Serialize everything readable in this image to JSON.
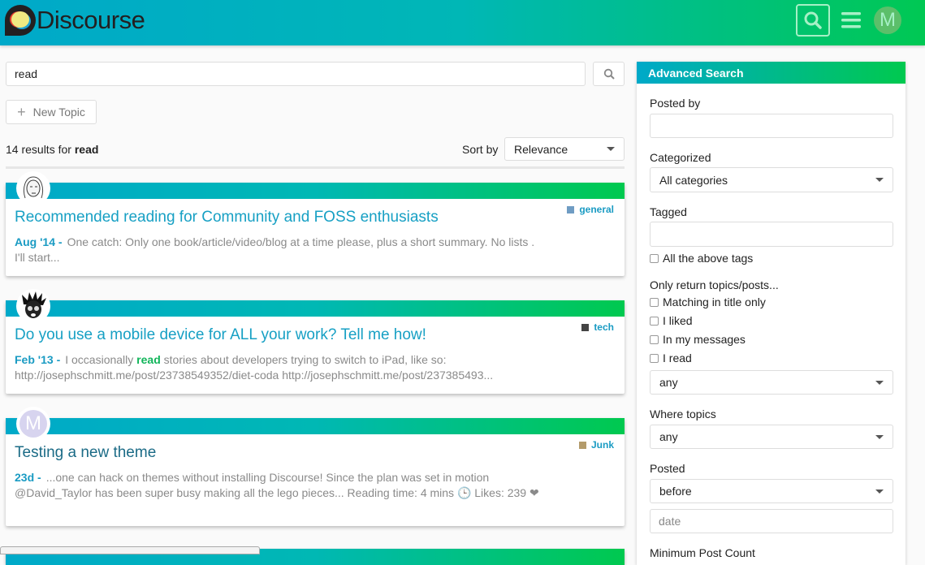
{
  "header": {
    "logo_text": "Discourse",
    "avatar_letter": "M",
    "icons": [
      "search-icon",
      "hamburger-menu-icon",
      "user-avatar"
    ]
  },
  "search": {
    "value": "read",
    "button_icon": "search-icon"
  },
  "new_topic": {
    "icon": "plus-icon",
    "label": "New Topic"
  },
  "results": {
    "count_prefix": "14 results for ",
    "term": "read",
    "sort_label": "Sort by",
    "sort_value": "Relevance"
  },
  "colors": {
    "accent": "#00a9c9",
    "accent_end": "#00c94f",
    "link": "#1a9bc3",
    "highlight": "#11b55a"
  },
  "topics": [
    {
      "title": "Recommended reading for Community and FOSS enthusiasts",
      "category": "general",
      "category_color": "#6f9cc3",
      "date": "Aug '14 -",
      "blurb_before": "One catch: Only one book/article/video/blog at a time please, plus a short summary. No lists . I'll start...",
      "highlight": "",
      "blurb_after": "",
      "avatar": "sketch-portrait"
    },
    {
      "title": "Do you use a mobile device for ALL your work? Tell me how!",
      "category": "tech",
      "category_color": "#444444",
      "date": "Feb '13 -",
      "blurb_before": "I occasionally ",
      "highlight": "read",
      "blurb_after": " stories about developers trying to switch to iPad, like so: http://josephschmitt.me/post/23738549352/diet-coda http://josephschmitt.me/post/237385493...",
      "avatar": "spiky-hair-cartoon"
    },
    {
      "title": "Testing a new theme",
      "category": "Junk",
      "category_color": "#b39b6b",
      "date": "23d -",
      "blurb_before": "...one can hack on themes without installing Discourse! Since the plan was set in motion @David_Taylor has been super busy making all the lego pieces... Reading time: 4 mins 🕒 Likes: 239 ❤",
      "highlight": "",
      "blurb_after": "",
      "avatar": "M"
    }
  ],
  "advanced": {
    "title": "Advanced Search",
    "posted_by": "Posted by",
    "categorized": "Categorized",
    "category_value": "All categories",
    "tagged": "Tagged",
    "all_tags": "All the above tags",
    "only_return": "Only return topics/posts...",
    "checks": [
      "Matching in title only",
      "I liked",
      "In my messages",
      "I read"
    ],
    "only_select": "any",
    "where_topics": "Where topics",
    "where_value": "any",
    "posted": "Posted",
    "posted_value": "before",
    "date_placeholder": "date",
    "min_post_count": "Minimum Post Count"
  }
}
